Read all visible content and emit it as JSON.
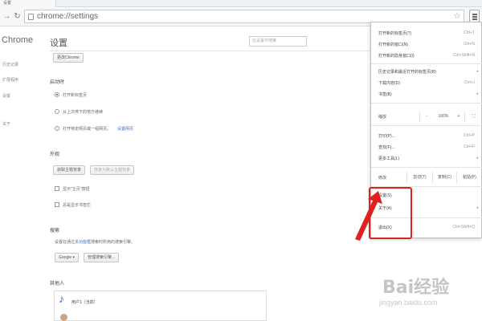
{
  "browser": {
    "tab_title": "设置",
    "url": "chrome://settings"
  },
  "sidebar": {
    "title": "Chrome",
    "items": [
      {
        "label": "历史记录"
      },
      {
        "label": "扩展程序"
      },
      {
        "label": "设置"
      },
      {
        "label": "关于"
      }
    ]
  },
  "settings": {
    "title": "设置",
    "search_placeholder": "在设置中搜索",
    "top_button": "更改Chrome",
    "startup": {
      "heading": "启动时",
      "options": [
        {
          "label": "打开新标签页",
          "checked": true
        },
        {
          "label": "从上次停下的地方继续",
          "checked": false
        },
        {
          "label": "打开特定网页或一组网页。",
          "checked": false,
          "link": "设置网页"
        }
      ]
    },
    "appearance": {
      "heading": "外观",
      "get_themes": "获取主题背景",
      "reset_theme": "恢复为默认主题背景",
      "show_home": "显示\"主页\"按钮",
      "show_bookmarks": "总是显示书签栏"
    },
    "search": {
      "heading": "搜索",
      "desc_prefix": "设置在通过",
      "desc_link": "多功能框",
      "desc_suffix": "搜索时所用的搜索引擎。",
      "engine": "Google ▾",
      "manage": "管理搜索引擎..."
    },
    "people": {
      "heading": "其他人",
      "user_label": "用户1（当前）"
    }
  },
  "menu": {
    "items_top": [
      {
        "label": "打开新的标签页(T)",
        "shortcut": "Ctrl+T"
      },
      {
        "label": "打开新的窗口(N)",
        "shortcut": "Ctrl+N"
      },
      {
        "label": "打开新的隐身窗口(I)",
        "shortcut": "Ctrl+Shift+N"
      }
    ],
    "items_mid": [
      {
        "label": "历史记录和最近打开的标签页(R)",
        "arrow": "▸"
      },
      {
        "label": "下载内容(D)",
        "shortcut": "Ctrl+J"
      },
      {
        "label": "书签(B)",
        "arrow": "▸"
      }
    ],
    "zoom": {
      "label": "缩放",
      "minus": "-",
      "value": "100%",
      "plus": "+",
      "fullscreen": "⛶"
    },
    "items_tools": [
      {
        "label": "打印(P)...",
        "shortcut": "Ctrl+P"
      },
      {
        "label": "查找(F)...",
        "shortcut": "Ctrl+F"
      },
      {
        "label": "更多工具(L)",
        "arrow": "▸"
      }
    ],
    "edit": {
      "label": "修改",
      "cut": "剪切(T)",
      "copy": "复制(C)",
      "paste": "粘贴(P)"
    },
    "items_bottom": [
      {
        "label": "设置(S)"
      },
      {
        "label": "关于(A)",
        "arrow": "▸"
      },
      {
        "label": "退出(X)",
        "shortcut": "Ctrl+Shift+Q"
      }
    ]
  },
  "annotation": {
    "highlight_color": "#e0201c"
  },
  "watermark": {
    "brand": "Bai经验",
    "site": "jingyan.baidu.com"
  }
}
